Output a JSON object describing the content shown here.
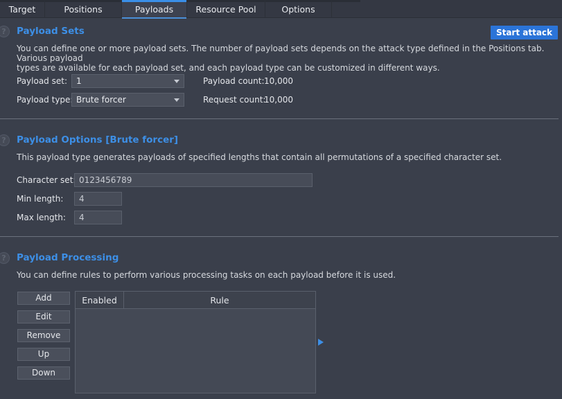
{
  "tabs": [
    "Target",
    "Positions",
    "Payloads",
    "Resource Pool",
    "Options"
  ],
  "help_icon_glyph": "?",
  "payload_sets": {
    "title": "Payload Sets",
    "start_attack": "Start attack",
    "description_line1": "You can define one or more payload sets. The number of payload sets depends on the attack type defined in the Positions tab. Various payload",
    "description_line2": "types are available for each payload set, and each payload type can be customized in different ways.",
    "payload_set_label": "Payload set:",
    "payload_set_value": "1",
    "payload_type_label": "Payload type:",
    "payload_type_value": "Brute forcer",
    "payload_count_label": "Payload count:",
    "payload_count_value": "10,000",
    "request_count_label": "Request count:",
    "request_count_value": "10,000"
  },
  "payload_options": {
    "title": "Payload Options [Brute forcer]",
    "description": "This payload type generates payloads of specified lengths that contain all permutations of a specified character set.",
    "charset_label": "Character set:",
    "charset_value": "0123456789",
    "min_label": "Min length:",
    "min_value": "4",
    "max_label": "Max length:",
    "max_value": "4"
  },
  "payload_processing": {
    "title": "Payload Processing",
    "description": "You can define rules to perform various processing tasks on each payload before it is used.",
    "buttons": [
      "Add",
      "Edit",
      "Remove",
      "Up",
      "Down"
    ],
    "columns": [
      "Enabled",
      "Rule"
    ]
  },
  "colors": {
    "accent": "#3d8fe6",
    "primary_button": "#2b74d8",
    "background": "#3a3f4b"
  }
}
